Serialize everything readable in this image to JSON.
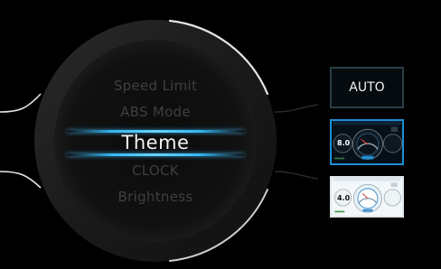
{
  "menu": {
    "items": [
      {
        "label": "Speed Limit"
      },
      {
        "label": "ABS Mode"
      },
      {
        "label": "Theme",
        "selected": true
      },
      {
        "label": "CLOCK"
      },
      {
        "label": "Brightness"
      }
    ]
  },
  "theme_options": [
    {
      "label": "AUTO",
      "type": "text"
    },
    {
      "label": "dark dashboard theme",
      "type": "thumbnail",
      "speed_value": "8.0",
      "selected": true
    },
    {
      "label": "light dashboard theme",
      "type": "thumbnail",
      "speed_value": "4.0"
    }
  ],
  "colors": {
    "background": "#000000",
    "accent": "#1d8fd6",
    "menu_item_dim": "#3f3f3f",
    "menu_item_selected": "#f2f2f2"
  }
}
